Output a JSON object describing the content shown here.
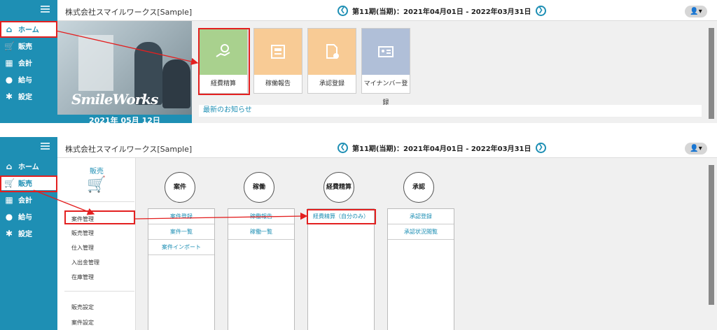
{
  "company": "株式会社スマイルワークス[Sample]",
  "period": "第11期(当期)：2021年04月01日 - 2022年03月31日",
  "prev_glyph": "❮",
  "next_glyph": "❯",
  "user_glyph": "👤▾",
  "nav": [
    {
      "label": "ホーム",
      "icon": "home-icon"
    },
    {
      "label": "販売",
      "icon": "cart-icon"
    },
    {
      "label": "会計",
      "icon": "calculator-icon"
    },
    {
      "label": "給与",
      "icon": "money-bag-icon"
    },
    {
      "label": "設定",
      "icon": "gear-icon"
    }
  ],
  "top": {
    "banner_logo": "SmileWorks",
    "banner_date": "2021年 05月 12日",
    "tiles": [
      {
        "label": "経費精算",
        "color": "#a9d18e",
        "icon": "hand-money-icon"
      },
      {
        "label": "稼働報告",
        "color": "#f8cb95",
        "icon": "report-icon"
      },
      {
        "label": "承認登録",
        "color": "#f8cb95",
        "icon": "document-check-icon"
      },
      {
        "label": "マイナンバー登録",
        "color": "#b0bfd8",
        "icon": "id-card-icon"
      }
    ],
    "news_title": "最新のお知らせ"
  },
  "bottom": {
    "submenu_title": "販売",
    "submenu_items": [
      "案件管理",
      "販売管理",
      "仕入管理",
      "入出金管理",
      "在庫管理"
    ],
    "submenu_items2": [
      "販売設定",
      "案件設定"
    ],
    "categories": [
      {
        "title": "案件",
        "links": [
          "案件登録",
          "案件一覧",
          "案件インポート"
        ]
      },
      {
        "title": "稼働",
        "links": [
          "稼働報告",
          "稼働一覧"
        ]
      },
      {
        "title": "経費精算",
        "links": [
          "経費精算（自分のみ）"
        ]
      },
      {
        "title": "承認",
        "links": [
          "承認登録",
          "承認状況閲覧"
        ]
      }
    ]
  },
  "colors": {
    "accent": "#1e8fb4",
    "highlight": "#e32020"
  }
}
